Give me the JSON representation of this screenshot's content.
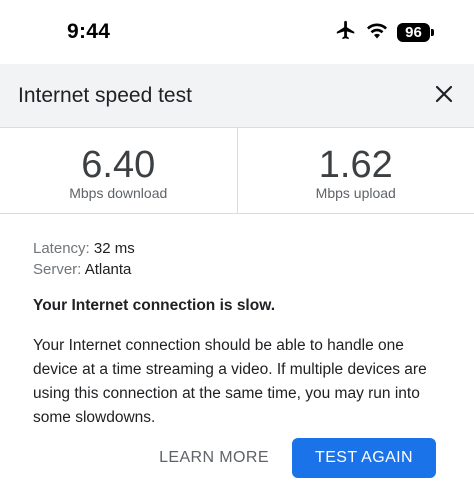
{
  "status_bar": {
    "time": "9:44",
    "battery_level": "96",
    "icons": [
      "airplane-icon",
      "wifi-icon",
      "battery-icon"
    ]
  },
  "header": {
    "title": "Internet speed test",
    "close_icon": "close-icon"
  },
  "results": {
    "download_value": "6.40",
    "download_unit": "Mbps download",
    "upload_value": "1.62",
    "upload_unit": "Mbps upload"
  },
  "details": {
    "latency_label": "Latency:",
    "latency_value": "32 ms",
    "server_label": "Server:",
    "server_value": "Atlanta"
  },
  "message": {
    "heading": "Your Internet connection is slow.",
    "body": "Your Internet connection should be able to handle one device at a time streaming a video. If multiple devices are using this connection at the same time, you may run into some slowdowns."
  },
  "actions": {
    "learn_more": "LEARN MORE",
    "test_again": "TEST AGAIN"
  },
  "colors": {
    "accent": "#1a73e8",
    "header_bg": "#f1f3f4",
    "divider": "#dadce0"
  }
}
